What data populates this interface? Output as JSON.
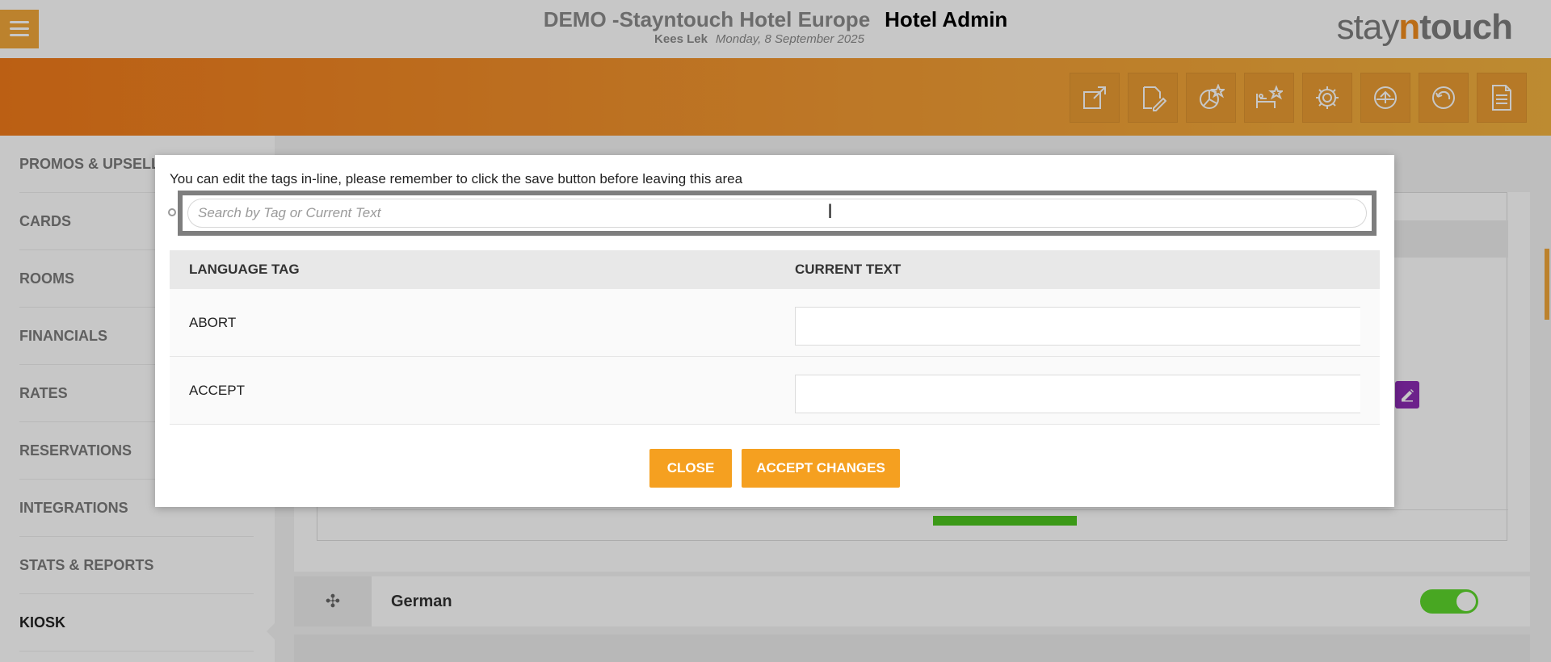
{
  "header": {
    "hotel_name": "DEMO -Stayntouch Hotel Europe",
    "app_title": "Hotel Admin",
    "user_name": "Kees Lek",
    "date": "Monday, 8 September 2025",
    "logo": {
      "stay": "stay",
      "n": "n",
      "touch": "touch"
    },
    "menu_icon": "hamburger-icon"
  },
  "toolbar": {
    "icons": [
      "external-link-icon",
      "edit-document-icon",
      "dashboard-star-icon",
      "bed-star-icon",
      "gear-icon",
      "upload-icon",
      "undo-icon",
      "document-icon"
    ]
  },
  "sidebar": {
    "items": [
      {
        "label": "PROMOS & UPSELL"
      },
      {
        "label": "CARDS"
      },
      {
        "label": "ROOMS"
      },
      {
        "label": "FINANCIALS"
      },
      {
        "label": "RATES"
      },
      {
        "label": "RESERVATIONS"
      },
      {
        "label": "INTEGRATIONS"
      },
      {
        "label": "STATS & REPORTS"
      },
      {
        "label": "KIOSK"
      }
    ],
    "active": "KIOSK"
  },
  "background": {
    "language_row": {
      "name": "German",
      "enabled": true
    }
  },
  "modal": {
    "instruction": "You can edit the tags in-line, please remember to click the save button before leaving this area",
    "search": {
      "placeholder": "Search by Tag or Current Text",
      "value": ""
    },
    "columns": [
      "LANGUAGE TAG",
      "CURRENT TEXT"
    ],
    "rows": [
      {
        "tag": "ABORT",
        "text": ""
      },
      {
        "tag": "ACCEPT",
        "text": ""
      }
    ],
    "close_label": "CLOSE",
    "accept_label": "ACCEPT CHANGES"
  },
  "colors": {
    "accent": "#f5a020",
    "toolbar_start": "#f07a1a",
    "toolbar_end": "#f3b23f",
    "purple": "#8b2bb3",
    "toggle_on": "#5dd62c"
  }
}
